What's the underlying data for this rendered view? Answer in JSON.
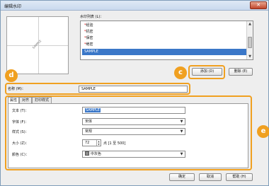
{
  "window": {
    "title": "编辑水印",
    "close_glyph": "✕"
  },
  "preview": {
    "watermark_text": "SAMPLE"
  },
  "list": {
    "label": "水印列表 (L)：",
    "items": [
      "经验",
      "机密",
      "保密",
      "绝密",
      "SAMPLE"
    ],
    "star": "*"
  },
  "buttons": {
    "add": "添加 (D)",
    "delete": "删除 (E)",
    "ok": "确定",
    "cancel": "取消",
    "help": "帮助 (H)"
  },
  "name_field": {
    "label": "名称 (M)：",
    "value": "SAMPLE"
  },
  "tabs": [
    "属性",
    "对齐",
    "打印样式"
  ],
  "properties": {
    "text_label": "文本 (T)：",
    "text_value": "SAMPLE",
    "font_label": "字体 (F)：",
    "font_value": "宋体",
    "style_label": "样式 (S)：",
    "style_value": "常规",
    "size_label": "大小 (Z)：",
    "size_value": "72",
    "size_unit": "点 [1 至 500]",
    "color_label": "颜色 (C)：",
    "color_value": "中灰色"
  },
  "badges": {
    "c": "c",
    "d": "d",
    "e": "e"
  },
  "colors": {
    "accent": "#f0a020",
    "selection": "#3a77c8"
  }
}
